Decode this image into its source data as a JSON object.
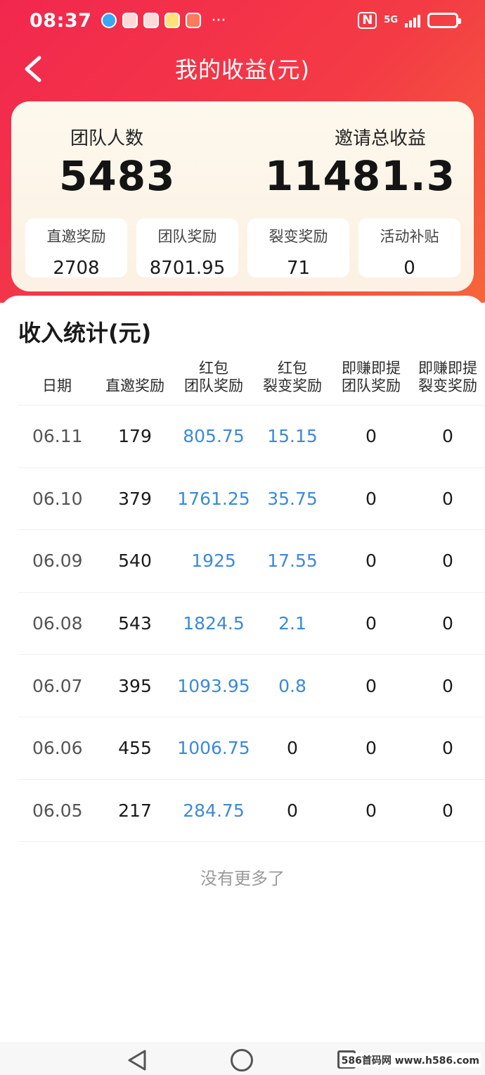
{
  "status_bar": {
    "time": "08:37",
    "more": "···",
    "nfc": "N",
    "network": "5G",
    "battery_level": 0.78
  },
  "nav": {
    "title": "我的收益(元)"
  },
  "summary": {
    "team_label": "团队人数",
    "team_value": "5483",
    "invite_label": "邀请总收益",
    "invite_value": "11481.3",
    "subcards": [
      {
        "label": "直邀奖励",
        "value": "2708"
      },
      {
        "label": "团队奖励",
        "value": "8701.95"
      },
      {
        "label": "裂变奖励",
        "value": "71"
      },
      {
        "label": "活动补贴",
        "value": "0"
      }
    ]
  },
  "income": {
    "title": "收入统计(元)",
    "headers": [
      {
        "line1": "",
        "line2": "日期"
      },
      {
        "line1": "",
        "line2": "直邀奖励"
      },
      {
        "line1": "红包",
        "line2": "团队奖励"
      },
      {
        "line1": "红包",
        "line2": "裂变奖励"
      },
      {
        "line1": "即赚即提",
        "line2": "团队奖励"
      },
      {
        "line1": "即赚即提",
        "line2": "裂变奖励"
      }
    ],
    "rows": [
      [
        "06.11",
        "179",
        "805.75",
        "15.15",
        "0",
        "0"
      ],
      [
        "06.10",
        "379",
        "1761.25",
        "35.75",
        "0",
        "0"
      ],
      [
        "06.09",
        "540",
        "1925",
        "17.55",
        "0",
        "0"
      ],
      [
        "06.08",
        "543",
        "1824.5",
        "2.1",
        "0",
        "0"
      ],
      [
        "06.07",
        "395",
        "1093.95",
        "0.8",
        "0",
        "0"
      ],
      [
        "06.06",
        "455",
        "1006.75",
        "0",
        "0",
        "0"
      ],
      [
        "06.05",
        "217",
        "284.75",
        "0",
        "0",
        "0"
      ]
    ],
    "no_more": "没有更多了"
  },
  "watermark": "586首码网 www.h586.com",
  "colors": {
    "header_start": "#f2274e",
    "header_end": "#f6663a",
    "value_blue": "#3c8ad6",
    "card_bg": "#fdf8ed"
  }
}
